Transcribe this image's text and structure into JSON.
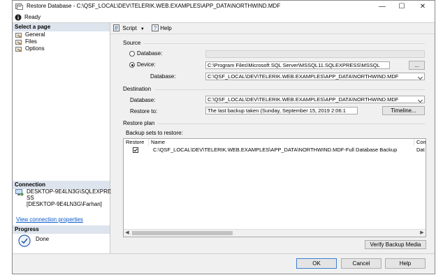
{
  "window": {
    "title": "Restore Database - C:\\QSF_LOCAL\\DEV\\TELERIK.WEB.EXAMPLES\\APP_DATA\\NORTHWIND.MDF"
  },
  "status": {
    "text": "Ready"
  },
  "select_page": {
    "header": "Select a page",
    "items": [
      {
        "label": "General"
      },
      {
        "label": "Files"
      },
      {
        "label": "Options"
      }
    ]
  },
  "connection": {
    "header": "Connection",
    "server_line1": "DESKTOP-9E4LN3G\\SQLEXPRE",
    "server_line2": "SS",
    "user": "[DESKTOP-9E4LN3G\\Farhan]",
    "link": "View connection properties"
  },
  "progress": {
    "header": "Progress",
    "status": "Done"
  },
  "toolbar": {
    "script_label": "Script",
    "help_label": "Help"
  },
  "source": {
    "group_label": "Source",
    "database_radio": "Database:",
    "device_radio": "Device:",
    "device_value": "C:\\Program Files\\Microsoft SQL Server\\MSSQL11.SQLEXPRESS\\MSSQL",
    "browse_label": "...",
    "database_label": "Database:",
    "database_value": "C:\\QSF_LOCAL\\DEV\\TELERIK.WEB.EXAMPLES\\APP_DATA\\NORTHWIND.MDF"
  },
  "destination": {
    "group_label": "Destination",
    "database_label": "Database:",
    "database_value": "C:\\QSF_LOCAL\\DEV\\TELERIK.WEB.EXAMPLES\\APP_DATA\\NORTHWIND.MDF",
    "restore_to_label": "Restore to:",
    "restore_to_value": "The last backup taken (Sunday, September 15, 2019 2:06:1",
    "timeline_label": "Timeline..."
  },
  "restore_plan": {
    "group_label": "Restore plan",
    "backup_sets_label": "Backup sets to restore:",
    "columns": {
      "restore": "Restore",
      "name": "Name",
      "component": "Com"
    },
    "rows": [
      {
        "restore": true,
        "name": "C:\\QSF_LOCAL\\DEV\\TELERIK.WEB.EXAMPLES\\APP_DATA\\NORTHWIND.MDF-Full Database Backup",
        "component": "Dat"
      }
    ],
    "verify_label": "Verify Backup Media"
  },
  "buttons": {
    "ok": "OK",
    "cancel": "Cancel",
    "help": "Help"
  },
  "colors": {
    "link": "#0a58ca",
    "ok_border": "#3c7fd1",
    "section_header": "#dde4ee"
  }
}
